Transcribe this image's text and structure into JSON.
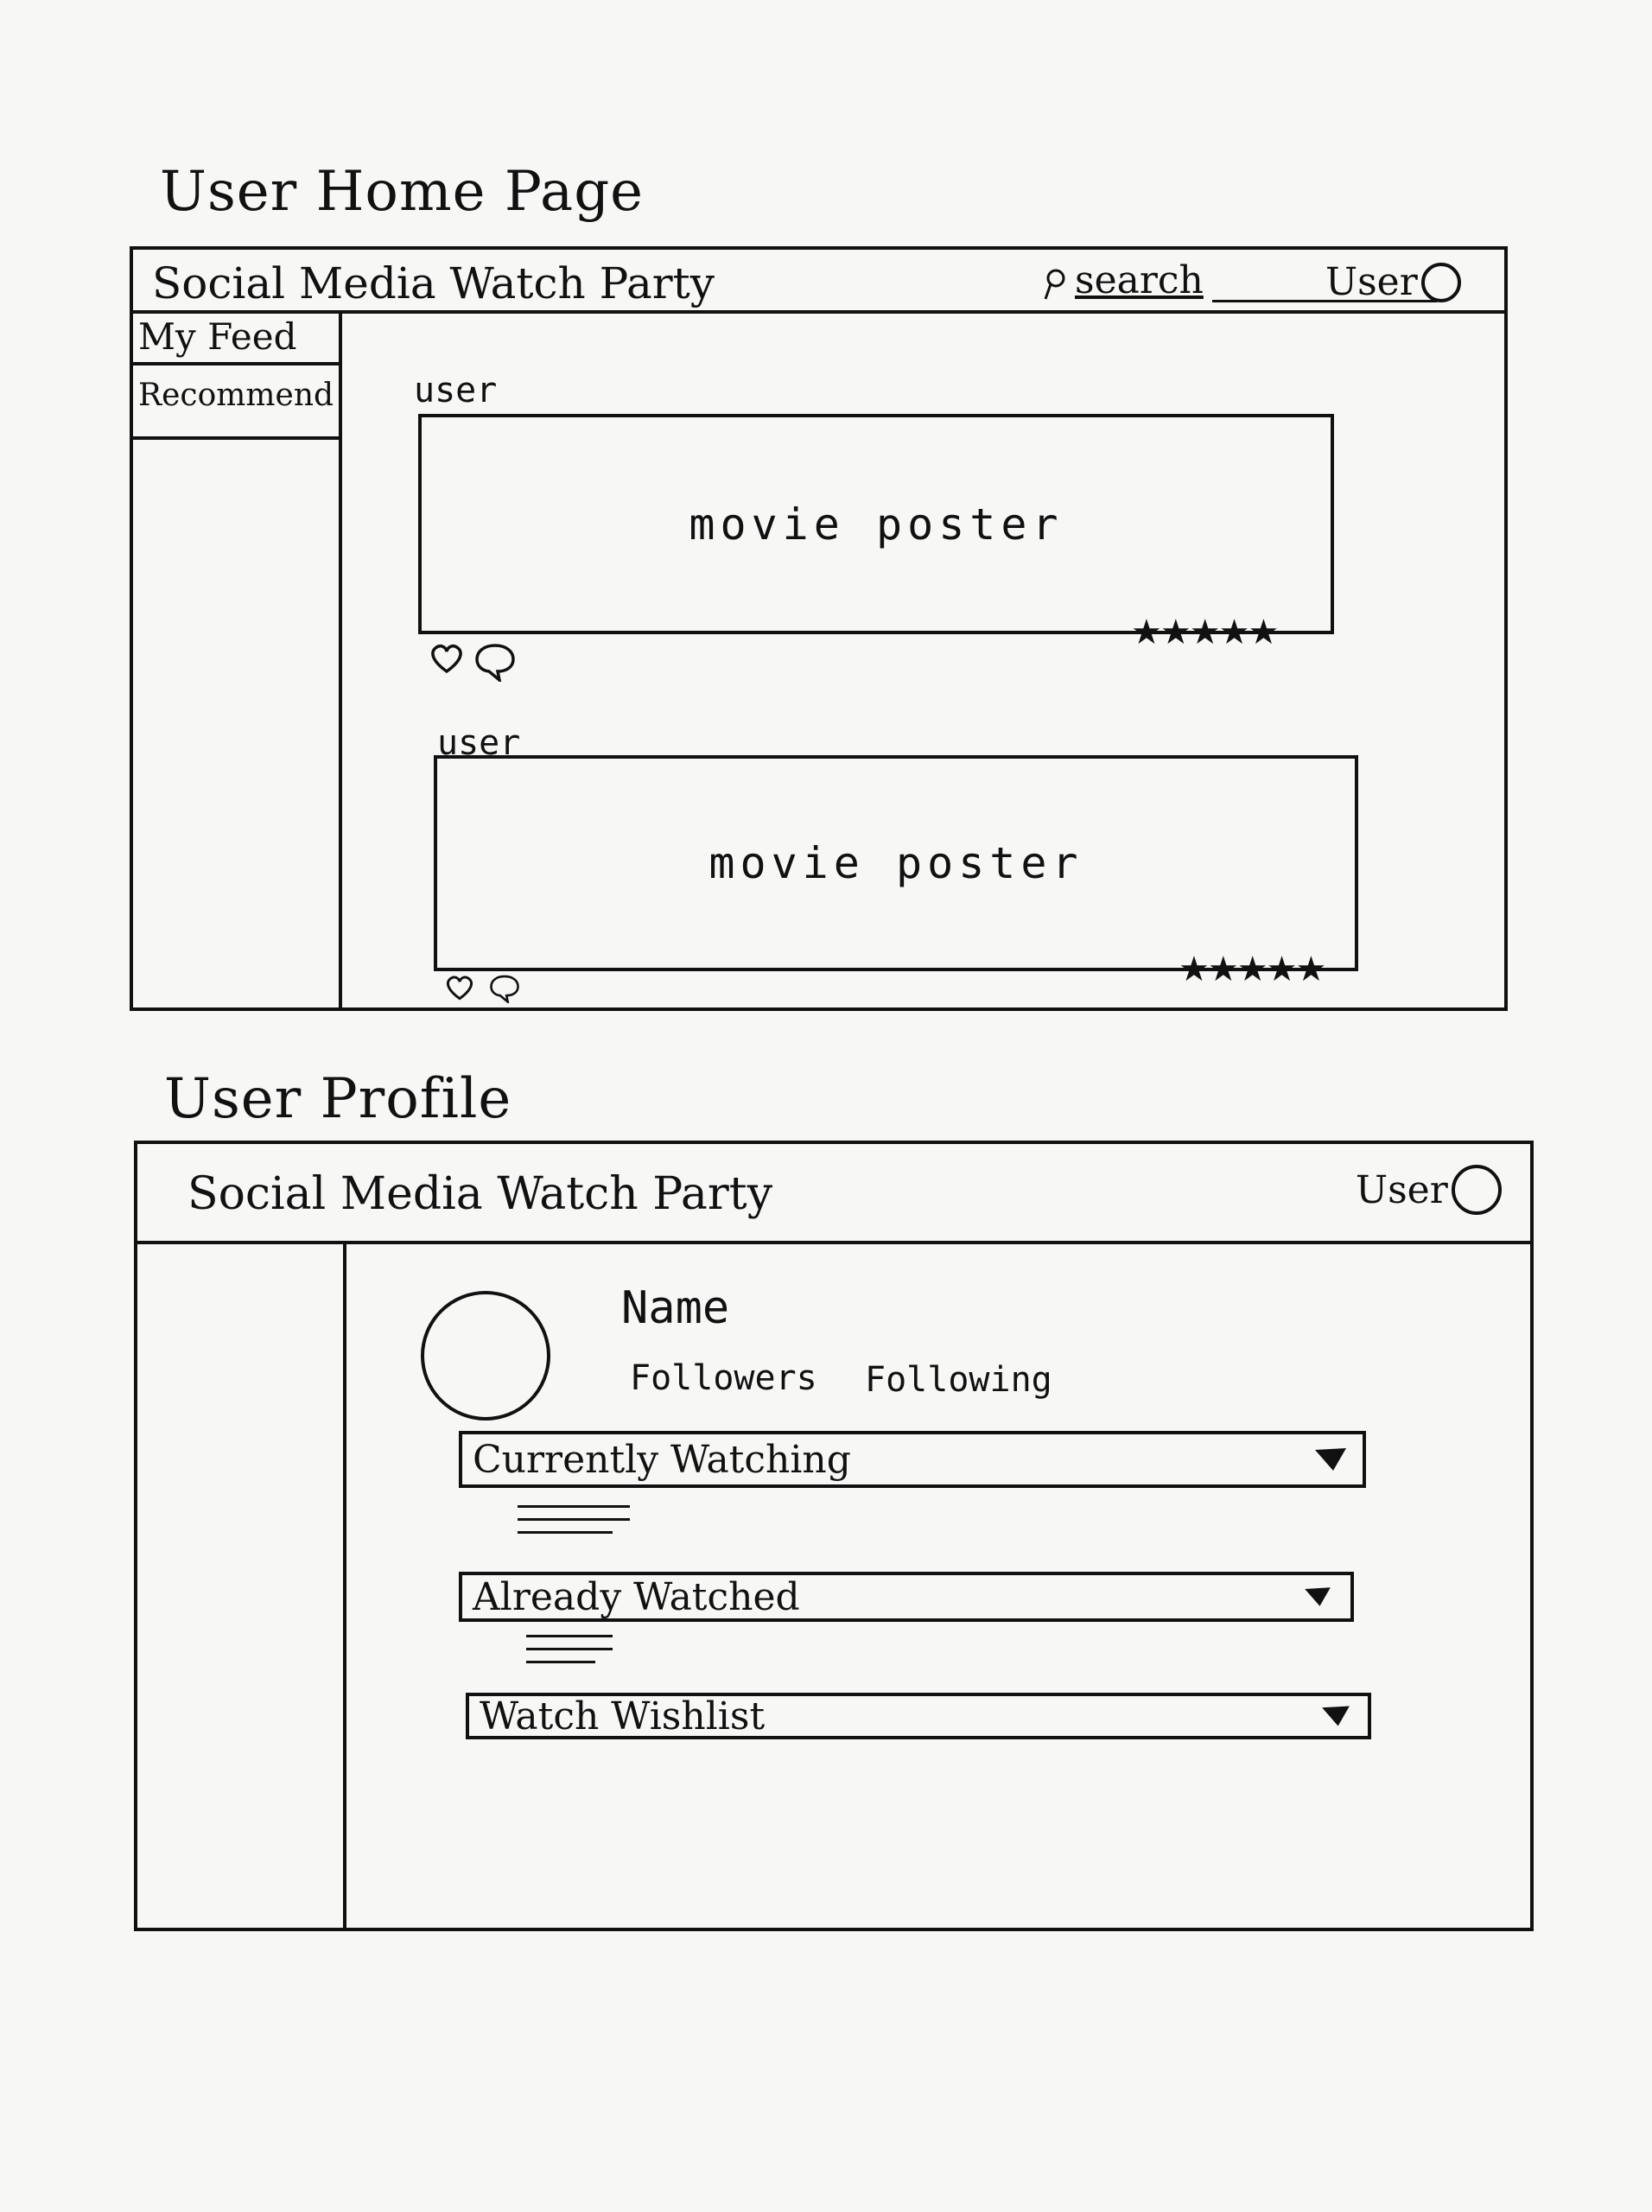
{
  "home": {
    "section_title": "User Home Page",
    "app_title": "Social Media Watch Party",
    "search_label": "search",
    "user_label": "User",
    "sidebar": [
      "My Feed",
      "Recommend"
    ],
    "posts": [
      {
        "user": "user",
        "poster": "movie poster",
        "stars": "★★★★★"
      },
      {
        "user": "user",
        "poster": "movie poster",
        "stars": "★★★★★"
      }
    ]
  },
  "profile": {
    "section_title": "User Profile",
    "app_title": "Social Media Watch Party",
    "user_label": "User",
    "name": "Name",
    "followers": "Followers",
    "following": "Following",
    "lists": [
      "Currently Watching",
      "Already Watched",
      "Watch Wishlist"
    ]
  }
}
